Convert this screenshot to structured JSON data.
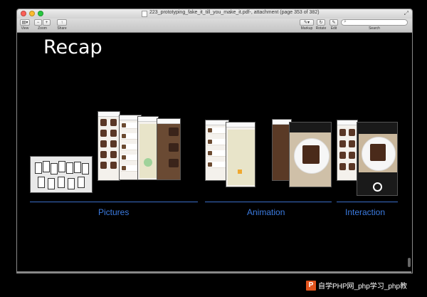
{
  "window": {
    "title": "223_prototyping_fake_it_till_you_make_it.pdf-, attachment (page 353 of 382)"
  },
  "toolbar": {
    "view_label": "View",
    "zoom_label": "Zoom",
    "share_label": "Share",
    "markup_label": "Markup",
    "rotate_label": "Rotate",
    "edit_label": "Edit",
    "search_label": "Search",
    "search_placeholder": ""
  },
  "slide": {
    "title": "Recap",
    "sections": [
      {
        "label": "Pictures"
      },
      {
        "label": "Animation"
      },
      {
        "label": "Interaction"
      }
    ]
  },
  "watermark": {
    "text": "自学PHP网_php学习_php教"
  },
  "colors": {
    "slide_bg": "#000000",
    "accent_blue": "#3b7be0",
    "window_border": "#888888"
  }
}
